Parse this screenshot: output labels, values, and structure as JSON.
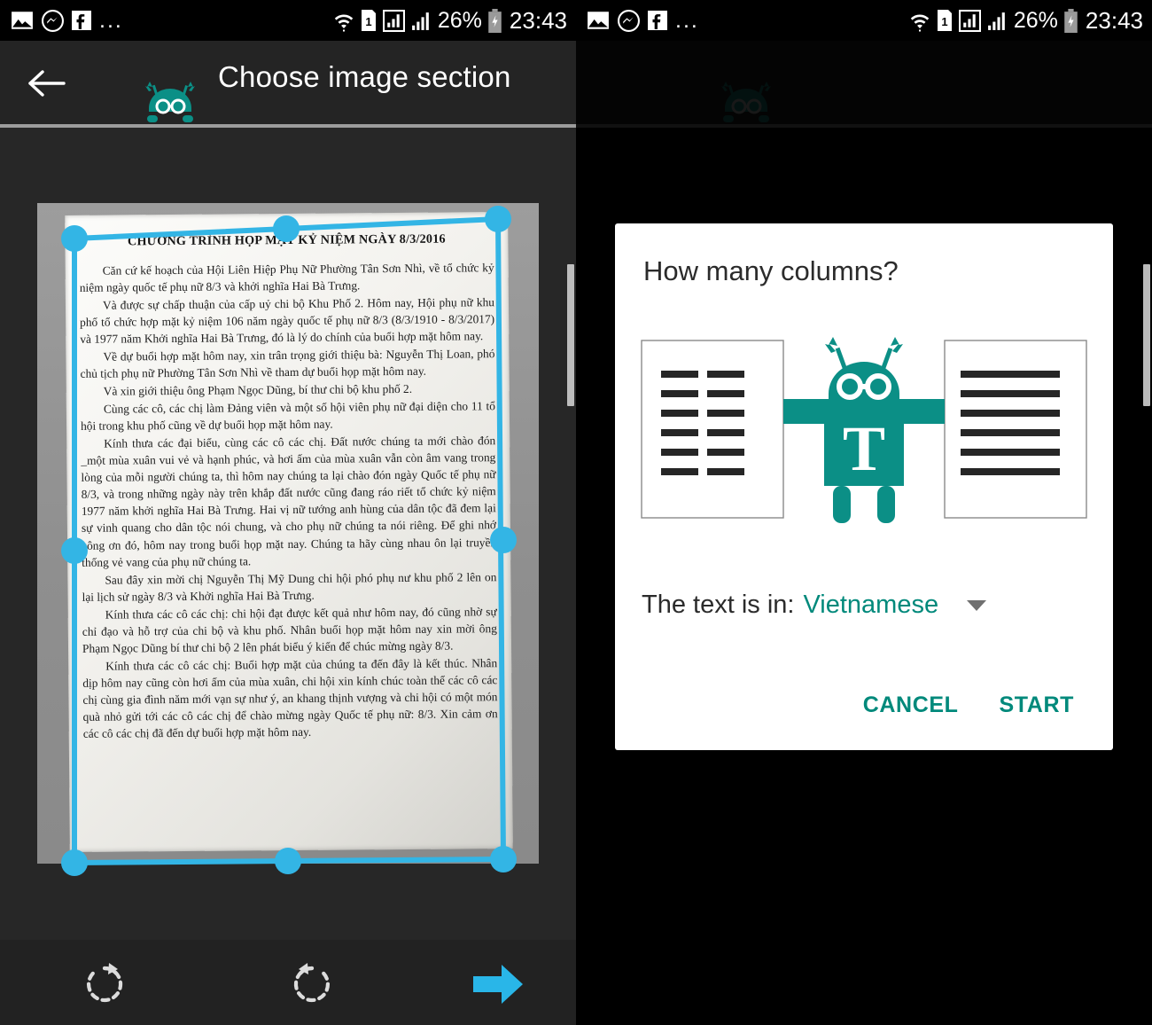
{
  "statusbar": {
    "left_icons": [
      "image-icon",
      "messenger-icon",
      "facebook-icon"
    ],
    "overflow": "...",
    "right_icons": [
      "wifi-icon",
      "sim-1-icon",
      "signal-bars-icon",
      "signal-bars-2-icon",
      "battery-charging-icon"
    ],
    "battery_percent": "26%",
    "clock": "23:43"
  },
  "appbar": {
    "title": "Choose image section",
    "back_label": "Back",
    "mascot": "robot-mascot"
  },
  "crop": {
    "handles_label": "Crop handle",
    "handle_color": "#33b5e5"
  },
  "document": {
    "title": "CHƯƠNG TRÌNH HỌP MẶT KỶ NIỆM NGÀY 8/3/2016",
    "paragraphs": [
      "Căn cứ kế hoạch của Hội Liên Hiệp Phụ Nữ Phường Tân Sơn Nhì, về tổ chức kỷ niệm ngày quốc tế phụ nữ 8/3 và khởi nghĩa Hai Bà Trưng.",
      "Và được sự chấp thuận của cấp uỷ chi bộ Khu Phố 2. Hôm nay, Hội phụ nữ khu phố tổ chức hợp mặt kỷ niệm 106 năm ngày quốc tế phụ nữ 8/3 (8/3/1910 - 8/3/2017) và 1977 năm Khởi nghĩa Hai Bà Trưng, đó là lý do chính của buổi hợp mặt hôm nay.",
      "Về dự buổi hợp mặt hôm nay, xin trân trọng giới thiệu bà: Nguyễn Thị Loan, phó chủ tịch phụ nữ Phường Tân Sơn Nhì về tham dự buổi họp mặt hôm nay.",
      "Và xin giới thiệu ông Phạm Ngọc Dũng, bí thư chi bộ khu phố 2.",
      "Cùng các cô, các chị làm Đảng viên và một số hội viên phụ nữ đại diện cho 11 tổ hội trong khu phố cũng về dự buổi họp mặt hôm nay.",
      "Kính thưa các đại biểu, cùng các cô các chị. Đất nước chúng ta mới chào đón _một mùa xuân vui vẻ và hạnh phúc, và hơi ấm của mùa xuân vẫn còn âm vang trong lòng của mỗi người chúng ta, thì hôm nay chúng ta lại chào đón ngày Quốc tế phụ nữ 8/3, và trong những ngày này trên khắp đất nước cũng đang ráo riết tổ chức kỷ niệm 1977 năm khởi nghĩa Hai Bà Trưng. Hai vị nữ tướng anh hùng của dân tộc đã đem lại sự vinh quang cho dân tộc nói chung, và cho phụ nữ chúng ta nói riêng. Để ghi nhớ công ơn đó, hôm nay trong buổi họp mặt nay. Chúng ta hãy cùng nhau ôn lại truyền thống vẻ vang của phụ nữ chúng ta.",
      "Sau đây xin mời chị Nguyễn Thị Mỹ Dung chi hội phó phụ nư khu phố 2 lên on lại lịch sử ngày 8/3 và Khởi nghĩa Hai Bà Trưng.",
      "Kính thưa các cô các chị: chi hội đạt được kết quả như hôm nay, đó cũng nhờ sự chỉ đạo và hỗ trợ của chi bộ và khu phố. Nhân buổi họp mặt hôm nay xin mời ông Phạm Ngọc Dũng bí thư chi bộ 2 lên phát biểu ý kiến để chúc mừng ngày 8/3.",
      "Kính thưa các cô các chị: Buổi hợp mặt của chúng ta đến đây là kết thúc. Nhân dịp hôm nay cũng còn hơi ấm của mùa xuân, chi hội xin kính chúc toàn thể các cô các chị cùng gia đình năm mới vạn sự như ý, an khang thịnh vượng và chi hội có một món quà nhỏ gửi tới các cô các chị để chào mừng ngày Quốc tế phụ nữ: 8/3. Xin cảm ơn các cô các chị đã đến dự buổi hợp mặt hôm nay."
    ]
  },
  "toolbar": {
    "rotate_cw": "rotate-clockwise",
    "rotate_ccw": "rotate-counterclockwise",
    "next": "next-arrow"
  },
  "dialog": {
    "title": "How many columns?",
    "option_two_columns": "two-column-layout",
    "option_one_column": "one-column-layout",
    "mascot": "robot-mascot",
    "language_label": "The text is in:",
    "language_value": "Vietnamese",
    "cancel_label": "CANCEL",
    "start_label": "START"
  },
  "colors": {
    "accent_teal": "#00897b",
    "handle_blue": "#33b5e5",
    "next_arrow_blue": "#29b6e8"
  }
}
